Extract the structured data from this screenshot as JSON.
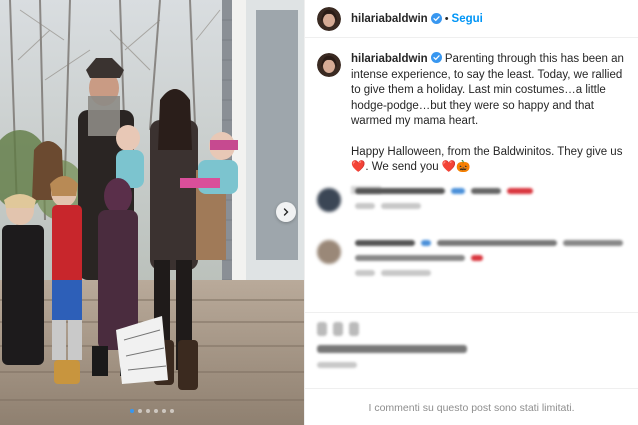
{
  "post": {
    "username": "hilariabaldwin",
    "verified_icon": "verified-badge-icon",
    "separator": "•",
    "follow_label": "Segui",
    "caption_line1": "Parenting through this has been an intense experience, to say the least. Today, we rallied to give them a holiday. Last min costumes…a little hodge-podge…but they were so happy and that warmed my mama heart.",
    "caption_line2": "Happy Halloween, from the Baldwinitos. They give us ❤️. We send you ❤️🎃",
    "comments_limited": "I commenti su questo post sono stati limitati."
  },
  "carousel": {
    "slide_count": 6,
    "active_index": 0,
    "next_icon": "chevron-right-icon"
  },
  "colors": {
    "accent": "#0095f6",
    "verified": "#3897f0",
    "heart": "#ed4956"
  }
}
